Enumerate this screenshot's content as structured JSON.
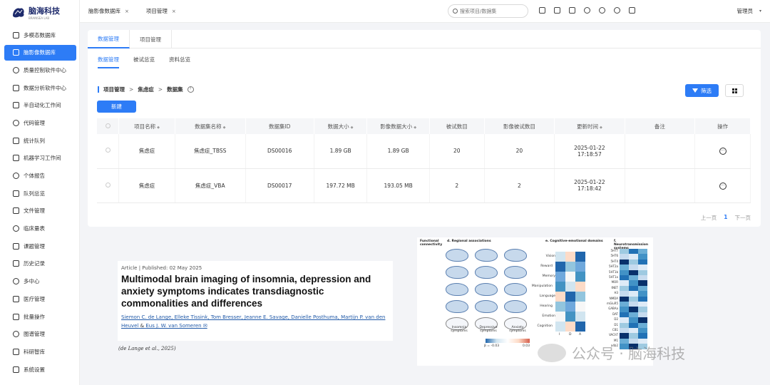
{
  "app": {
    "brand": "脑海科技",
    "brand_sub": "BRAINSEA LAB"
  },
  "sidebar": {
    "items": [
      {
        "label": "多模态数据库",
        "icon": "database-icon"
      },
      {
        "label": "脑影像数据库",
        "icon": "brain-icon",
        "active": true
      },
      {
        "label": "质量控制软件中心",
        "icon": "shield-icon"
      },
      {
        "label": "数据分析软件中心",
        "icon": "analysis-icon"
      },
      {
        "label": "半自动化工作间",
        "icon": "workflow-icon"
      },
      {
        "label": "代码管理",
        "icon": "code-icon"
      },
      {
        "label": "统计队列",
        "icon": "stats-icon"
      },
      {
        "label": "机器学习工作间",
        "icon": "ml-icon"
      },
      {
        "label": "个体报告",
        "icon": "report-icon"
      },
      {
        "label": "队列总览",
        "icon": "list-icon"
      },
      {
        "label": "文件管理",
        "icon": "folder-icon"
      },
      {
        "label": "临床量表",
        "icon": "clipboard-icon"
      },
      {
        "label": "课题管理",
        "icon": "topic-icon"
      },
      {
        "label": "历史记录",
        "icon": "history-icon"
      },
      {
        "label": "多中心",
        "icon": "multicenter-icon"
      },
      {
        "label": "医疗管理",
        "icon": "medical-icon"
      },
      {
        "label": "批量操作",
        "icon": "batch-icon"
      },
      {
        "label": "图谱管理",
        "icon": "atlas-icon"
      },
      {
        "label": "科研智库",
        "icon": "brain-think-icon"
      },
      {
        "label": "系统设置",
        "icon": "gear-icon"
      }
    ]
  },
  "topbar": {
    "tabs": [
      {
        "label": "脑影像数据库",
        "close": "×"
      },
      {
        "label": "项目管理",
        "close": "×"
      }
    ],
    "search_placeholder": "搜索项目/数据集",
    "user": "管理员",
    "caret": "▾"
  },
  "panel": {
    "tabs": [
      "数据管理",
      "项目管理"
    ],
    "subtabs": [
      "数据管理",
      "被试总览",
      "资料总览"
    ],
    "breadcrumb": [
      "项目管理",
      "焦虑症",
      "数据集"
    ],
    "breadcrumb_sep": ">",
    "help": "?",
    "new_button": "新建",
    "filter_button": "筛选",
    "table": {
      "headers": [
        "项目名称",
        "数据集名称",
        "数据集ID",
        "数据大小",
        "影像数据大小",
        "被试数目",
        "影像被试数目",
        "更新时间",
        "备注",
        "操作"
      ],
      "rows": [
        {
          "project": "焦虑症",
          "dataset": "焦虑症_TBSS",
          "id": "DS00016",
          "size": "1.89 GB",
          "img_size": "1.89 GB",
          "subjects": "20",
          "img_subjects": "20",
          "updated_date": "2025-01-22",
          "updated_time": "17:18:57",
          "note": ""
        },
        {
          "project": "焦虑症",
          "dataset": "焦虑症_VBA",
          "id": "DS00017",
          "size": "197.72 MB",
          "img_size": "193.05 MB",
          "subjects": "2",
          "img_subjects": "2",
          "updated_date": "2025-01-22",
          "updated_time": "17:18:42",
          "note": ""
        }
      ],
      "sort_glyph": "◆",
      "more_glyph": "···"
    },
    "pager": {
      "prev": "上一页",
      "current": "1",
      "next": "下一页"
    }
  },
  "article": {
    "type": "Article",
    "published": "Published: 02 May 2025",
    "title": "Multimodal brain imaging of insomnia, depression and anxiety symptoms indicates transdiagnostic commonalities and differences",
    "authors_line1": "Siemon C. de Lange, Elleke Tissink, Tom Bresser, Jeanne E. Savage, Danielle Posthuma, Martijn P. van den",
    "authors_line2": "Heuvel",
    "amp": "&",
    "authors_last": "Eus J. W. van Someren",
    "citation": "(de Lange et al., 2025)"
  },
  "figure": {
    "panel_a": "Functional connectivity",
    "panel_d": "d. Regional associations",
    "panel_e": "e. Cognitive-emotional domains",
    "panel_f": "f. Neurotransmission systems",
    "brain_labels": [
      "Insomnia symptoms",
      "Depressive symptoms",
      "Anxiety symptoms"
    ],
    "domains": [
      "Vision",
      "Reward",
      "Memory",
      "Manipulation",
      "Language",
      "Hearing",
      "Emotion",
      "Cognition"
    ],
    "receptors": [
      "5HT7",
      "5HT6",
      "5HT4",
      "5HT2a",
      "5HT1b",
      "5HT1a",
      "MOR",
      "tNET",
      "H3",
      "NMDA",
      "mGluR5",
      "GABAa",
      "DAT",
      "D2",
      "D1",
      "CB1",
      "VAChT",
      "M1",
      "a4b2"
    ],
    "scale_left": "β = -0.03",
    "scale_right": "0.03",
    "cols": [
      "I",
      "D",
      "A"
    ]
  },
  "watermark": {
    "text": "公众号 · 脑海科技"
  },
  "colors": {
    "accent": "#2d7cf6",
    "heat_neg": "#2166ac",
    "heat_pos": "#d6604d"
  }
}
